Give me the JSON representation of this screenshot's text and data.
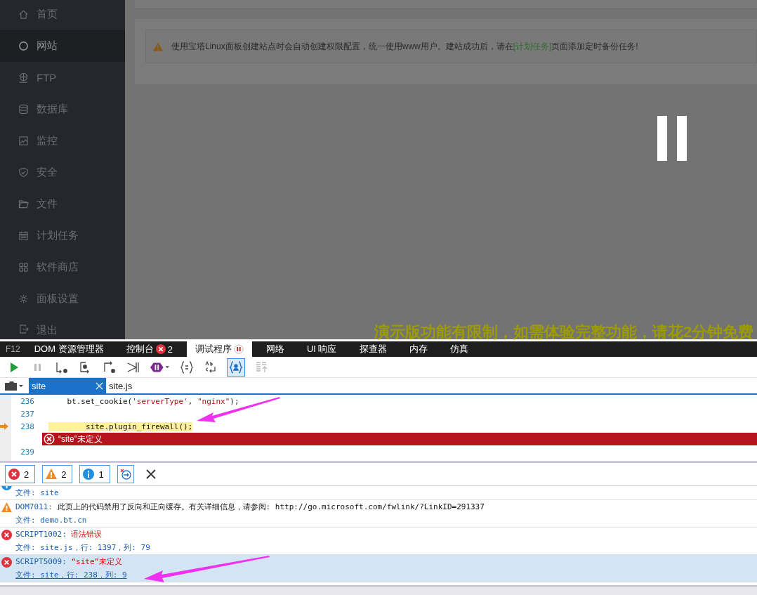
{
  "sidebar": {
    "items": [
      {
        "label": "首页",
        "selected": false
      },
      {
        "label": "网站",
        "selected": true
      },
      {
        "label": "FTP",
        "selected": false
      },
      {
        "label": "数据库",
        "selected": false
      },
      {
        "label": "监控",
        "selected": false
      },
      {
        "label": "安全",
        "selected": false
      },
      {
        "label": "文件",
        "selected": false
      },
      {
        "label": "计划任务",
        "selected": false
      },
      {
        "label": "软件商店",
        "selected": false
      },
      {
        "label": "面板设置",
        "selected": false
      },
      {
        "label": "退出",
        "selected": false
      }
    ]
  },
  "notice": {
    "text": "使用宝塔Linux面板创建站点时会自动创建权限配置，统一使用www用户。建站成功后，请在",
    "link": "[计划任务]",
    "text_end": "页面添加定时备份任务!"
  },
  "paused": true,
  "demo_banner": "演示版功能有限制，如需体验完整功能，请花2分钟免费",
  "devtools": {
    "label": "F12",
    "tabs": [
      {
        "label": "DOM 资源管理器",
        "selected": false
      },
      {
        "label": "控制台",
        "selected": false,
        "badge": "2"
      },
      {
        "label": "调试程序",
        "selected": true,
        "paused": true
      },
      {
        "label": "网络",
        "selected": false
      },
      {
        "label": "UI 响应",
        "selected": false
      },
      {
        "label": "探查器",
        "selected": false
      },
      {
        "label": "内存",
        "selected": false
      },
      {
        "label": "仿真",
        "selected": false
      }
    ],
    "files": [
      {
        "label": "site",
        "selected": true
      },
      {
        "label": "site.js",
        "selected": false
      }
    ],
    "code": [
      {
        "line": "236",
        "current": false,
        "tokens": [
          {
            "kind": "plain",
            "text": "    bt.set_cookie("
          },
          {
            "kind": "string",
            "text": "'serverType'"
          },
          {
            "kind": "plain",
            "text": ", "
          },
          {
            "kind": "string",
            "text": "\"nginx\""
          },
          {
            "kind": "plain",
            "text": ");"
          }
        ]
      },
      {
        "line": "237",
        "current": false
      },
      {
        "line": "238",
        "current": true,
        "tokens": [
          {
            "kind": "plain",
            "text": "        site.plugin_firewall();"
          }
        ],
        "error": "“site”未定义"
      },
      {
        "line": "239",
        "current": false
      }
    ],
    "console": {
      "filters": [
        {
          "kind": "error",
          "count": "2"
        },
        {
          "kind": "warning",
          "count": "2"
        },
        {
          "kind": "info",
          "count": "1"
        }
      ],
      "messages": [
        {
          "kind": "info",
          "selected": false,
          "file": "文件: site"
        },
        {
          "kind": "warning",
          "selected": false,
          "code": "DOM7011:",
          "message": "此页上的代码禁用了反向和正向缓存。有关详细信息，请参阅: http://go.microsoft.com/fwlink/?LinkID=291337",
          "file": "文件: demo.bt.cn"
        },
        {
          "kind": "error",
          "selected": false,
          "code": "SCRIPT1002:",
          "message": "语法错误",
          "file": "文件: site.js，行: 1397，列: 79"
        },
        {
          "kind": "error",
          "selected": true,
          "code": "SCRIPT5009:",
          "message": "“site”未定义",
          "file": "文件: site，行: 238，列: 9"
        }
      ]
    }
  }
}
